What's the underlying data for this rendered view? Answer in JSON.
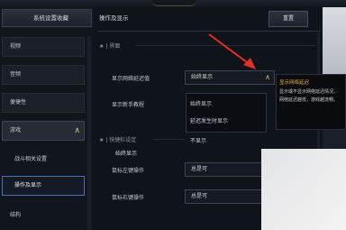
{
  "sidebar": {
    "title": "系统设置收藏",
    "items": [
      {
        "label": "视频"
      },
      {
        "label": "音频"
      },
      {
        "label": "便捷性"
      },
      {
        "label": "游戏"
      },
      {
        "label": "战斗相关设置"
      },
      {
        "label": "操作及显示"
      },
      {
        "label": "结构"
      }
    ]
  },
  "main": {
    "title": "操作及显示",
    "reset_label": "重置",
    "section_interface": "界面",
    "section_shortcut": "快捷栏设定",
    "rows": {
      "show_latency_label": "显示网络延迟值",
      "show_latency_value": "始终显示",
      "newbie_tutorial_label": "显示新手教程",
      "left_click_label": "鼠标左键操作",
      "left_click_value": "总是可",
      "right_click_label": "鼠标右键操作",
      "right_click_value": "总是可"
    },
    "popup_options": [
      "始终显示",
      "延迟发生时显示",
      "不显示"
    ]
  },
  "tooltip": {
    "title": "显示网络延迟",
    "lines": [
      "显示或不显示网络延迟情况，",
      "网络延迟越低，游戏越流畅。"
    ]
  },
  "colors": {
    "accent_gold": "#e8b33a",
    "selection_border": "#4a6fb0",
    "annotation_arrow": "#e0302a"
  }
}
